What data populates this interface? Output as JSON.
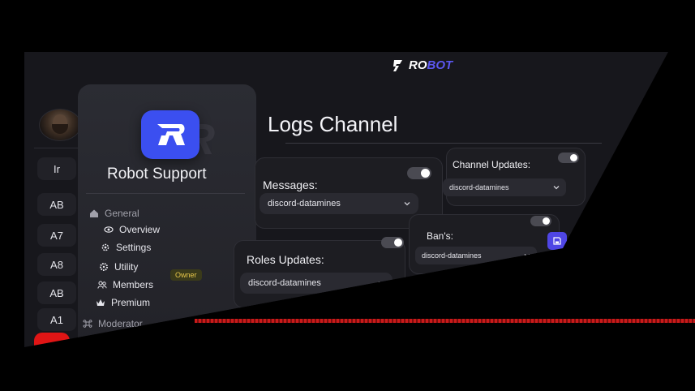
{
  "brand": {
    "prefix": "RO",
    "suffix": "BOT",
    "accent": "#5b57f0"
  },
  "rail": {
    "buttons": [
      "Ir",
      "AB",
      "A7",
      "A8",
      "AB",
      "A1"
    ]
  },
  "sidebar": {
    "server_name": "Robot Support",
    "sections": {
      "general": "General",
      "moderator": "Moderator"
    },
    "items": [
      {
        "label": "Overview",
        "icon": "eye-icon"
      },
      {
        "label": "Settings",
        "icon": "gear-icon"
      },
      {
        "label": "Utility",
        "icon": "cog-icon"
      },
      {
        "label": "Members",
        "icon": "members-icon",
        "badge": "Owner"
      },
      {
        "label": "Premium",
        "icon": "crown-icon"
      }
    ]
  },
  "main": {
    "title": "Logs Channel",
    "cards": [
      {
        "label": "Messages:",
        "value": "discord-datamines",
        "enabled": true
      },
      {
        "label": "Channel Updates:",
        "value": "discord-datamines",
        "enabled": true
      },
      {
        "label": "Roles Updates:",
        "value": "discord-datamines",
        "enabled": true
      },
      {
        "label": "Ban's:",
        "value": "discord-datamines",
        "enabled": true
      }
    ]
  },
  "colors": {
    "panel": "#17171c",
    "accent": "#4f46e5",
    "logo": "#3b4ff0"
  }
}
